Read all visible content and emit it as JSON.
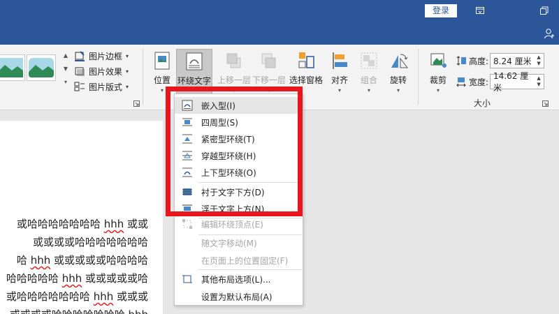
{
  "titlebar": {
    "login_label": "登录"
  },
  "ribbon": {
    "picture_styles": {
      "border_label": "图片边框",
      "effects_label": "图片效果",
      "layout_label": "图片版式"
    },
    "arrange": {
      "position_label": "位置",
      "wrap_text_label": "环绕文字",
      "bring_forward_label": "上移一层",
      "send_backward_label": "下移一层",
      "selection_pane_label": "选择窗格",
      "align_label": "对齐",
      "group_label": "组合",
      "rotate_label": "旋转"
    },
    "size": {
      "crop_label": "裁剪",
      "height_label": "高度:",
      "height_value": "8.24 厘米",
      "width_label": "宽度:",
      "width_value": "14.62 厘米",
      "group_label": "大小"
    }
  },
  "document": {
    "lines": [
      {
        "pre": "或哈哈哈哈哈哈哈 ",
        "u": "hhh",
        "post": " 或或"
      },
      {
        "pre": "或或或或哈哈哈哈哈哈哈",
        "u": "",
        "post": ""
      },
      {
        "pre": "哈 ",
        "u": "hhh",
        "post": " 或或或或或哈哈哈哈"
      },
      {
        "pre": "哈哈哈哈哈 ",
        "u": "hhh",
        "post": " 或或或或或哈"
      },
      {
        "pre": "或哈哈哈哈哈哈哈 ",
        "u": "hhh",
        "post": " 或或或"
      },
      {
        "pre": "或或或或哈哈哈哈哈哈哈 ",
        "u": "hhh",
        "post": ""
      }
    ]
  },
  "wrap_menu": {
    "items": [
      {
        "label": "嵌入型(I)",
        "selected": true,
        "enabled": true
      },
      {
        "label": "四周型(S)",
        "selected": false,
        "enabled": true
      },
      {
        "label": "紧密型环绕(T)",
        "selected": false,
        "enabled": true
      },
      {
        "label": "穿越型环绕(H)",
        "selected": false,
        "enabled": true
      },
      {
        "label": "上下型环绕(O)",
        "selected": false,
        "enabled": true
      },
      {
        "label": "衬于文字下方(D)",
        "selected": false,
        "enabled": true
      },
      {
        "label": "浮于文字上方(N)",
        "selected": false,
        "enabled": true
      },
      {
        "label": "编辑环绕顶点(E)",
        "selected": false,
        "enabled": false
      },
      {
        "label": "随文字移动(M)",
        "selected": false,
        "enabled": false
      },
      {
        "label": "在页面上的位置固定(F)",
        "selected": false,
        "enabled": false
      },
      {
        "label": "其他布局选项(L)...",
        "selected": false,
        "enabled": true
      },
      {
        "label": "设置为默认布局(A)",
        "selected": false,
        "enabled": true
      }
    ]
  },
  "colors": {
    "title_blue": "#2b579a",
    "highlight_red": "#e8141e"
  }
}
